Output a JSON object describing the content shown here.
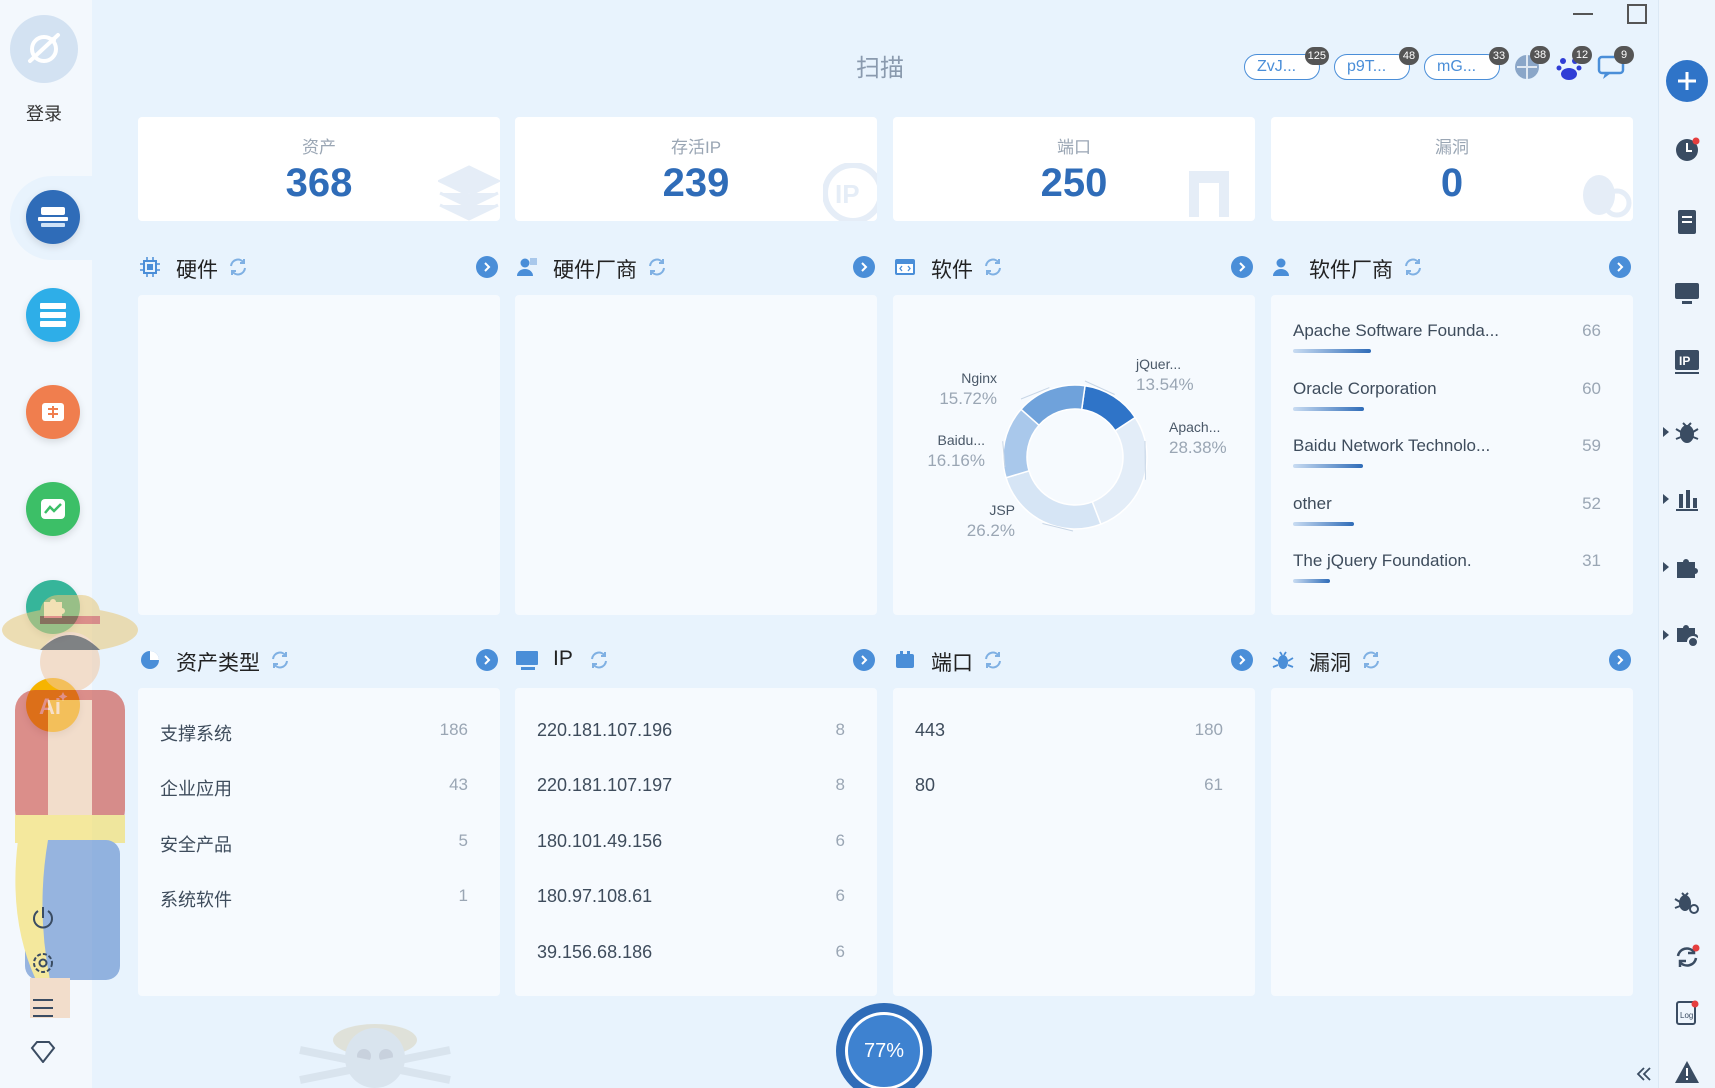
{
  "title": "扫描",
  "login_label": "登录",
  "top_tags": [
    {
      "label": "ZvJ...",
      "badge": "125"
    },
    {
      "label": "p9T...",
      "badge": "48"
    },
    {
      "label": "mG...",
      "badge": "33"
    }
  ],
  "top_icons": [
    {
      "name": "globe-icon",
      "badge": "38"
    },
    {
      "name": "baidu-icon",
      "badge": "12"
    },
    {
      "name": "chat-icon",
      "badge": "9"
    }
  ],
  "stats": [
    {
      "label": "资产",
      "value": "368"
    },
    {
      "label": "存活IP",
      "value": "239"
    },
    {
      "label": "端口",
      "value": "250"
    },
    {
      "label": "漏洞",
      "value": "0"
    }
  ],
  "sections": {
    "hardware": {
      "title": "硬件"
    },
    "hardware_vendor": {
      "title": "硬件厂商"
    },
    "software": {
      "title": "软件"
    },
    "software_vendor": {
      "title": "软件厂商"
    },
    "asset_type": {
      "title": "资产类型"
    },
    "ip": {
      "title": "IP"
    },
    "port": {
      "title": "端口"
    },
    "vuln": {
      "title": "漏洞"
    }
  },
  "software_vendors": [
    {
      "name": "Apache Software Founda...",
      "count": "66",
      "fraction": 0.66
    },
    {
      "name": "Oracle Corporation",
      "count": "60",
      "fraction": 0.6
    },
    {
      "name": "Baidu Network Technolo...",
      "count": "59",
      "fraction": 0.59
    },
    {
      "name": "other",
      "count": "52",
      "fraction": 0.52
    },
    {
      "name": "The jQuery Foundation.",
      "count": "31",
      "fraction": 0.31
    }
  ],
  "asset_types": [
    {
      "name": "支撑系统",
      "count": "186"
    },
    {
      "name": "企业应用",
      "count": "43"
    },
    {
      "name": "安全产品",
      "count": "5"
    },
    {
      "name": "系统软件",
      "count": "1"
    }
  ],
  "ips": [
    {
      "name": "220.181.107.196",
      "count": "8"
    },
    {
      "name": "220.181.107.197",
      "count": "8"
    },
    {
      "name": "180.101.49.156",
      "count": "6"
    },
    {
      "name": "180.97.108.61",
      "count": "6"
    },
    {
      "name": "39.156.68.186",
      "count": "6"
    }
  ],
  "ports": [
    {
      "name": "443",
      "count": "180"
    },
    {
      "name": "80",
      "count": "61"
    }
  ],
  "chart_data": {
    "type": "pie",
    "donut": true,
    "categories": [
      "jQuer...",
      "Apach...",
      "JSP",
      "Baidu...",
      "Nginx"
    ],
    "values": [
      13.54,
      28.38,
      26.2,
      16.16,
      15.72
    ],
    "value_labels": [
      "13.54%",
      "28.38%",
      "26.2%",
      "16.16%",
      "15.72%"
    ],
    "colors": [
      "#2f74c8",
      "#e3edf8",
      "#d6e5f5",
      "#a9c8eb",
      "#6fa2db"
    ]
  },
  "progress": {
    "label": "77%",
    "value": 77
  },
  "accent": "#2f6cb8"
}
